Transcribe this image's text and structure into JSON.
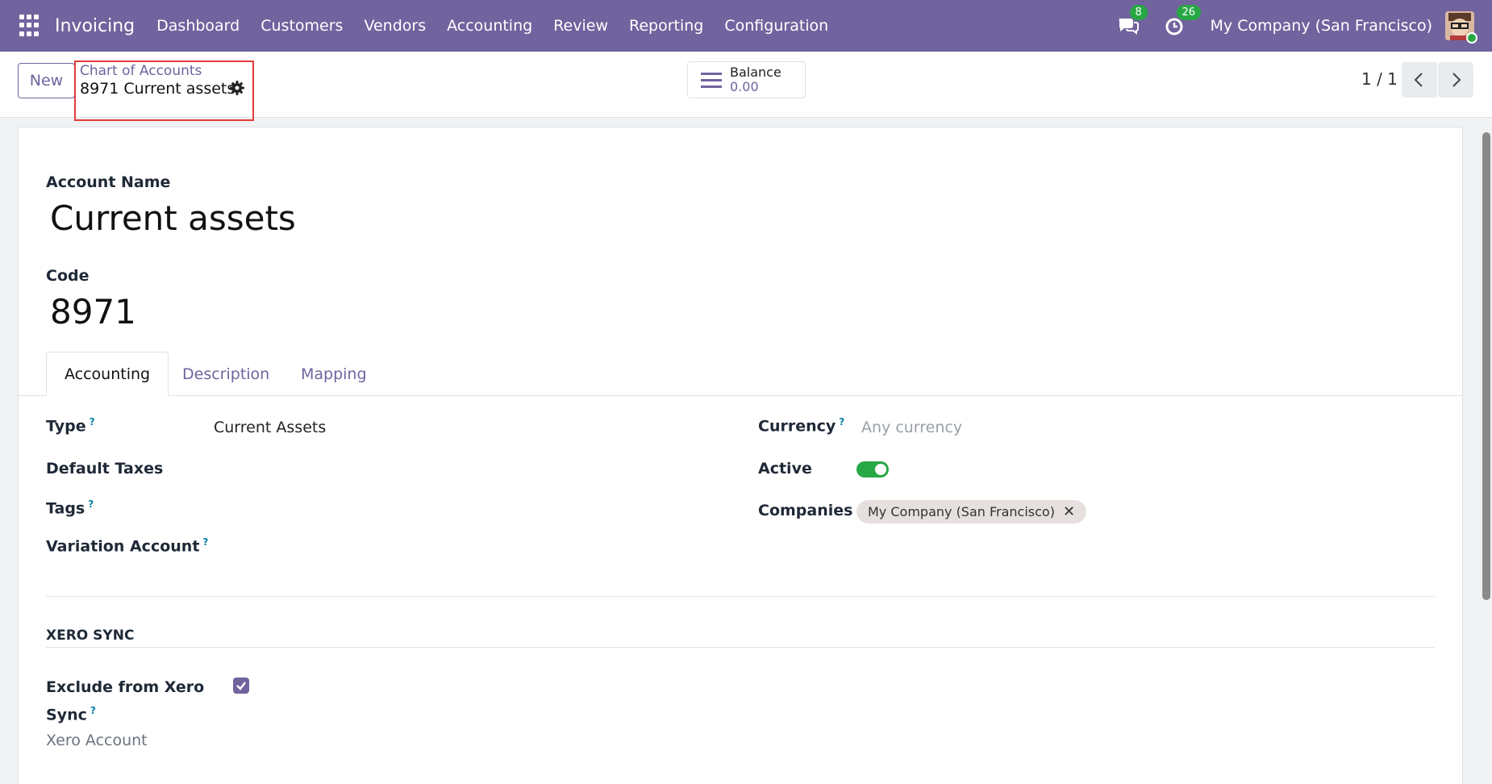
{
  "navbar": {
    "app_name": "Invoicing",
    "menu": [
      "Dashboard",
      "Customers",
      "Vendors",
      "Accounting",
      "Review",
      "Reporting",
      "Configuration"
    ],
    "messages_count": "8",
    "activities_count": "26",
    "company": "My Company (San Francisco)"
  },
  "control": {
    "new_label": "New",
    "breadcrumb_parent": "Chart of Accounts",
    "breadcrumb_current": "8971 Current assets",
    "balance_label": "Balance",
    "balance_value": "0.00",
    "pager": "1 / 1"
  },
  "form": {
    "account_name_label": "Account Name",
    "account_name": "Current assets",
    "code_label": "Code",
    "code": "8971",
    "tabs": [
      "Accounting",
      "Description",
      "Mapping"
    ],
    "type_label": "Type",
    "type_value": "Current Assets",
    "default_taxes_label": "Default Taxes",
    "tags_label": "Tags",
    "variation_account_label": "Variation Account",
    "currency_label": "Currency",
    "currency_placeholder": "Any currency",
    "active_label": "Active",
    "active": true,
    "companies_label": "Companies",
    "company_tag": "My Company (San Francisco)",
    "help_mark": "?",
    "xero_section": "XERO SYNC",
    "exclude_label_line1": "Exclude from Xero",
    "exclude_label_line2": "Sync",
    "exclude_checked": true,
    "xero_account_label": "Xero Account"
  },
  "colors": {
    "brand": "#71639e",
    "success": "#28a745",
    "highlight_box": "#e23b3b"
  }
}
